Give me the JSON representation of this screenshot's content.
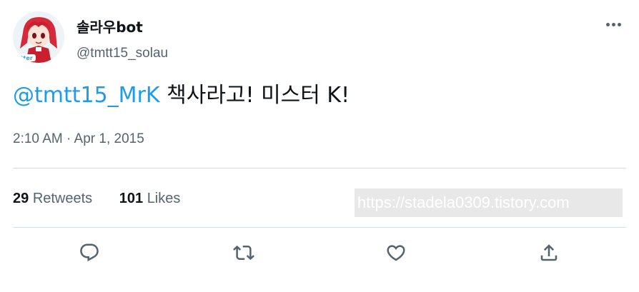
{
  "author": {
    "display_name": "솔라우bot",
    "handle": "@tmtt15_solau",
    "avatar_icon": "anime-character-avatar"
  },
  "tweet": {
    "mention": "@tmtt15_MrK",
    "text": " 책사라고! 미스터 K!",
    "timestamp": "2:10 AM · Apr 1, 2015"
  },
  "stats": {
    "retweets_count": "29",
    "retweets_label": "Retweets",
    "likes_count": "101",
    "likes_label": "Likes"
  },
  "watermark": {
    "text": "https://stadela0309.tistory.com"
  },
  "actions": [
    {
      "name": "reply",
      "icon": "reply-icon"
    },
    {
      "name": "retweet",
      "icon": "retweet-icon"
    },
    {
      "name": "like",
      "icon": "heart-icon"
    },
    {
      "name": "share",
      "icon": "share-icon"
    }
  ],
  "colors": {
    "accent": "#1d9bf0",
    "secondary_text": "#536471",
    "primary_text": "#0f1419",
    "divider": "#d6dde2"
  }
}
